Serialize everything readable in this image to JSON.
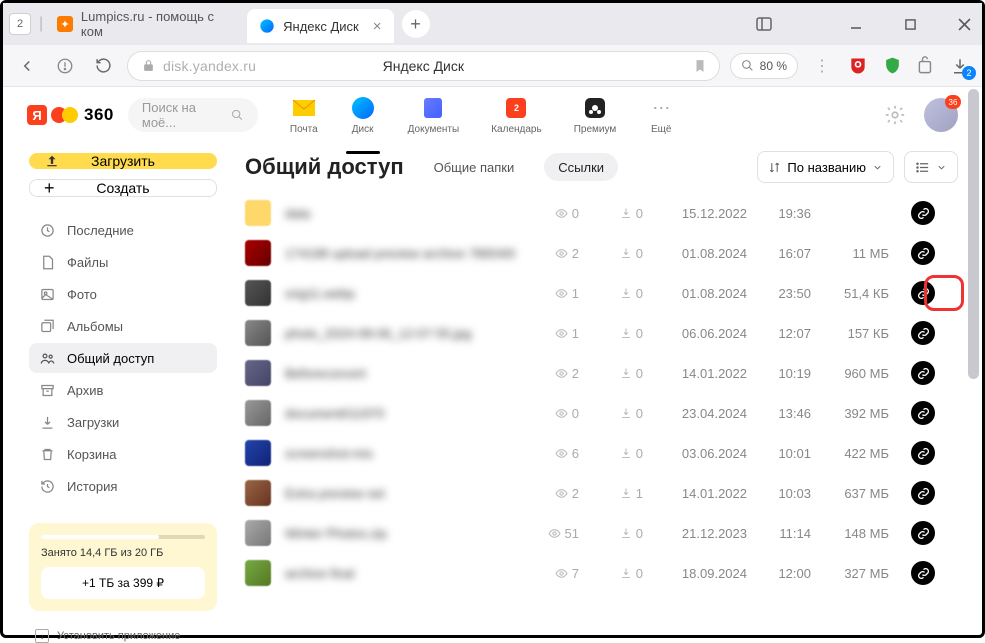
{
  "browser": {
    "tab_counter": "2",
    "inactive_tab": "Lumpics.ru - помощь с ком",
    "active_tab": "Яндекс Диск",
    "url": "disk.yandex.ru",
    "page_title": "Яндекс Диск",
    "zoom": "80 %",
    "download_badge": "2"
  },
  "header": {
    "logo_text": "360",
    "search_placeholder": "Поиск на моё...",
    "services": [
      {
        "label": "Почта"
      },
      {
        "label": "Диск"
      },
      {
        "label": "Документы"
      },
      {
        "label": "Календарь",
        "badge": "2"
      },
      {
        "label": "Премиум"
      },
      {
        "label": "Ещё"
      }
    ],
    "avatar_badge": "36"
  },
  "sidebar": {
    "upload": "Загрузить",
    "create": "Создать",
    "items": [
      {
        "label": "Последние"
      },
      {
        "label": "Файлы"
      },
      {
        "label": "Фото"
      },
      {
        "label": "Альбомы"
      },
      {
        "label": "Общий доступ"
      },
      {
        "label": "Архив"
      },
      {
        "label": "Загрузки"
      },
      {
        "label": "Корзина"
      },
      {
        "label": "История"
      }
    ],
    "storage_text": "Занято 14,4 ГБ из 20 ГБ",
    "storage_btn": "+1 ТБ за 399 ₽",
    "install": "Установить приложение"
  },
  "main": {
    "title": "Общий доступ",
    "tab_folders": "Общие папки",
    "tab_links": "Ссылки",
    "sort_label": "По названию",
    "files": [
      {
        "name": "data",
        "views": "0",
        "downloads": "0",
        "date": "15.12.2022",
        "time": "19:36",
        "size": ""
      },
      {
        "name": "174198 upload preview archive 7865400 jpg",
        "views": "2",
        "downloads": "0",
        "date": "01.08.2024",
        "time": "16:07",
        "size": "11 МБ"
      },
      {
        "name": "orig11.webp",
        "views": "1",
        "downloads": "0",
        "date": "01.08.2024",
        "time": "23:50",
        "size": "51,4 КБ"
      },
      {
        "name": "photo_2024-08-06_12-07-55.jpg",
        "views": "1",
        "downloads": "0",
        "date": "06.06.2024",
        "time": "12:07",
        "size": "157 КБ"
      },
      {
        "name": "Beforeconcert",
        "views": "2",
        "downloads": "0",
        "date": "14.01.2022",
        "time": "10:19",
        "size": "960 МБ"
      },
      {
        "name": "document011970",
        "views": "0",
        "downloads": "0",
        "date": "23.04.2024",
        "time": "13:46",
        "size": "392 МБ"
      },
      {
        "name": "screenshot-mix",
        "views": "6",
        "downloads": "0",
        "date": "03.06.2024",
        "time": "10:01",
        "size": "422 МБ"
      },
      {
        "name": "Extra preview set",
        "views": "2",
        "downloads": "1",
        "date": "14.01.2022",
        "time": "10:03",
        "size": "637 МБ"
      },
      {
        "name": "Winter Photos.zip",
        "views": "51",
        "downloads": "0",
        "date": "21.12.2023",
        "time": "11:14",
        "size": "148 МБ"
      },
      {
        "name": "archive final",
        "views": "7",
        "downloads": "0",
        "date": "18.09.2024",
        "time": "12:00",
        "size": "327 МБ"
      }
    ]
  }
}
